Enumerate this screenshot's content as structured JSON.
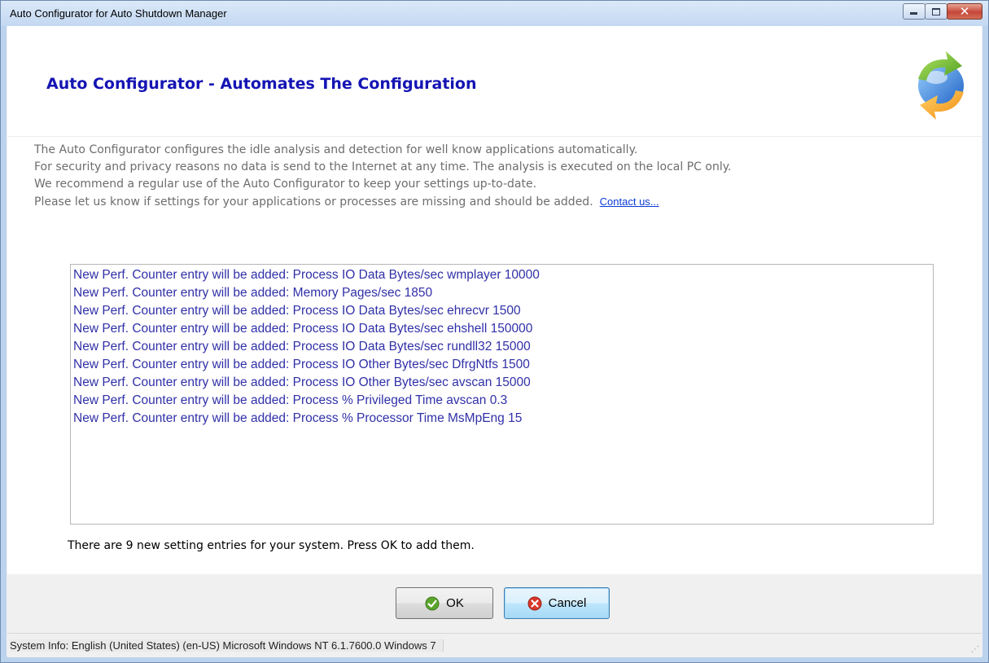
{
  "window": {
    "title": "Auto Configurator for Auto Shutdown Manager",
    "minimize": "",
    "maximize": "",
    "close": "✕"
  },
  "header": {
    "title": "Auto Configurator - Automates The Configuration",
    "logo_icon": "refresh-arrows-icon"
  },
  "intro": {
    "lines": [
      "The Auto Configurator configures the idle analysis and detection for well know applications automatically.",
      "For security and privacy reasons no data is send to the Internet  at any time. The analysis is executed on the local PC only.",
      "We recommend a regular use of the Auto Configurator to keep your settings up-to-date.",
      "Please let us know if settings for your applications or processes are missing and should be added."
    ],
    "contact_link": "Contact us..."
  },
  "entries": [
    "New Perf. Counter entry will be added: Process IO Data Bytes/sec wmplayer 10000",
    "New Perf. Counter entry will be added: Memory Pages/sec  1850",
    "New Perf. Counter entry will be added: Process IO Data Bytes/sec ehrecvr 1500",
    "New Perf. Counter entry will be added: Process IO Data Bytes/sec ehshell 150000",
    "New Perf. Counter entry will be added: Process IO Data Bytes/sec rundll32 15000",
    "New Perf. Counter entry will be added: Process IO Other Bytes/sec DfrgNtfs 1500",
    "New Perf. Counter entry will be added: Process IO Other Bytes/sec avscan 15000",
    "New Perf. Counter entry will be added: Process % Privileged Time avscan 0.3",
    "New Perf. Counter entry will be added: Process % Processor Time MsMpEng 15"
  ],
  "summary": "There are 9 new setting entries for your system. Press OK to add them.",
  "buttons": {
    "ok": "OK",
    "cancel": "Cancel",
    "ok_icon": "checkmark-icon",
    "cancel_icon": "close-circle-icon"
  },
  "status": {
    "text": "System Info:   English (United States) (en-US)  Microsoft Windows NT 6.1.7600.0 Windows 7"
  },
  "colors": {
    "header_title": "#1414b4",
    "list_text": "#3030a8",
    "link": "#0b3bd6",
    "intro_text": "#6d6d6d"
  }
}
